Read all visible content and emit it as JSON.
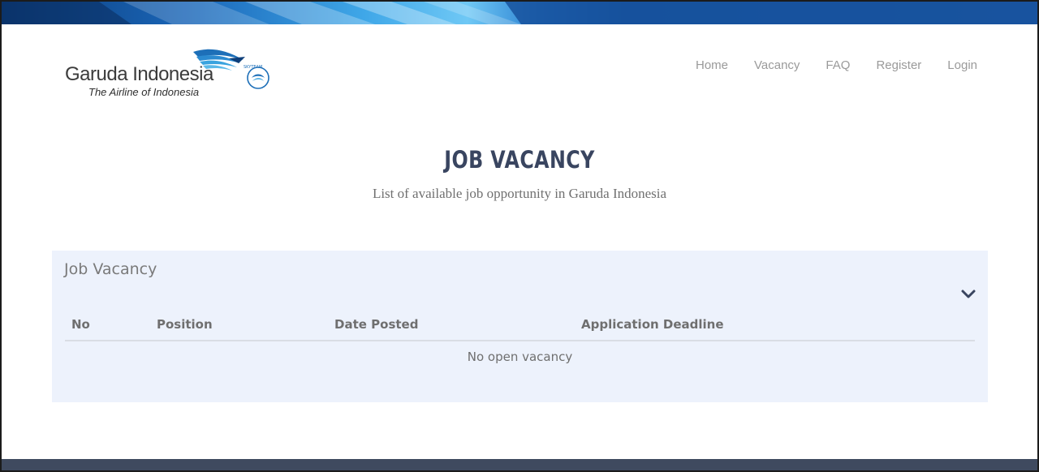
{
  "brand": {
    "name": "Garuda Indonesia",
    "tagline": "The Airline of Indonesia",
    "bird_color": "#1d6fb8",
    "seal_label": "SKYTEAM"
  },
  "nav": {
    "items": [
      {
        "label": "Home"
      },
      {
        "label": "Vacancy"
      },
      {
        "label": "FAQ"
      },
      {
        "label": "Register"
      },
      {
        "label": "Login"
      }
    ]
  },
  "hero": {
    "title": "JOB VACANCY",
    "subtitle": "List of available job opportunity in Garuda Indonesia"
  },
  "panel": {
    "title": "Job Vacancy",
    "toggle_icon": "chevron-down-icon",
    "table": {
      "columns": [
        "No",
        "Position",
        "Date Posted",
        "Application Deadline"
      ],
      "empty_message": "No open vacancy"
    }
  },
  "colors": {
    "title": "#394560",
    "panel_bg": "#edf2fc",
    "footer": "#3f4a5f",
    "banner_accent": "#3fa7e8"
  }
}
